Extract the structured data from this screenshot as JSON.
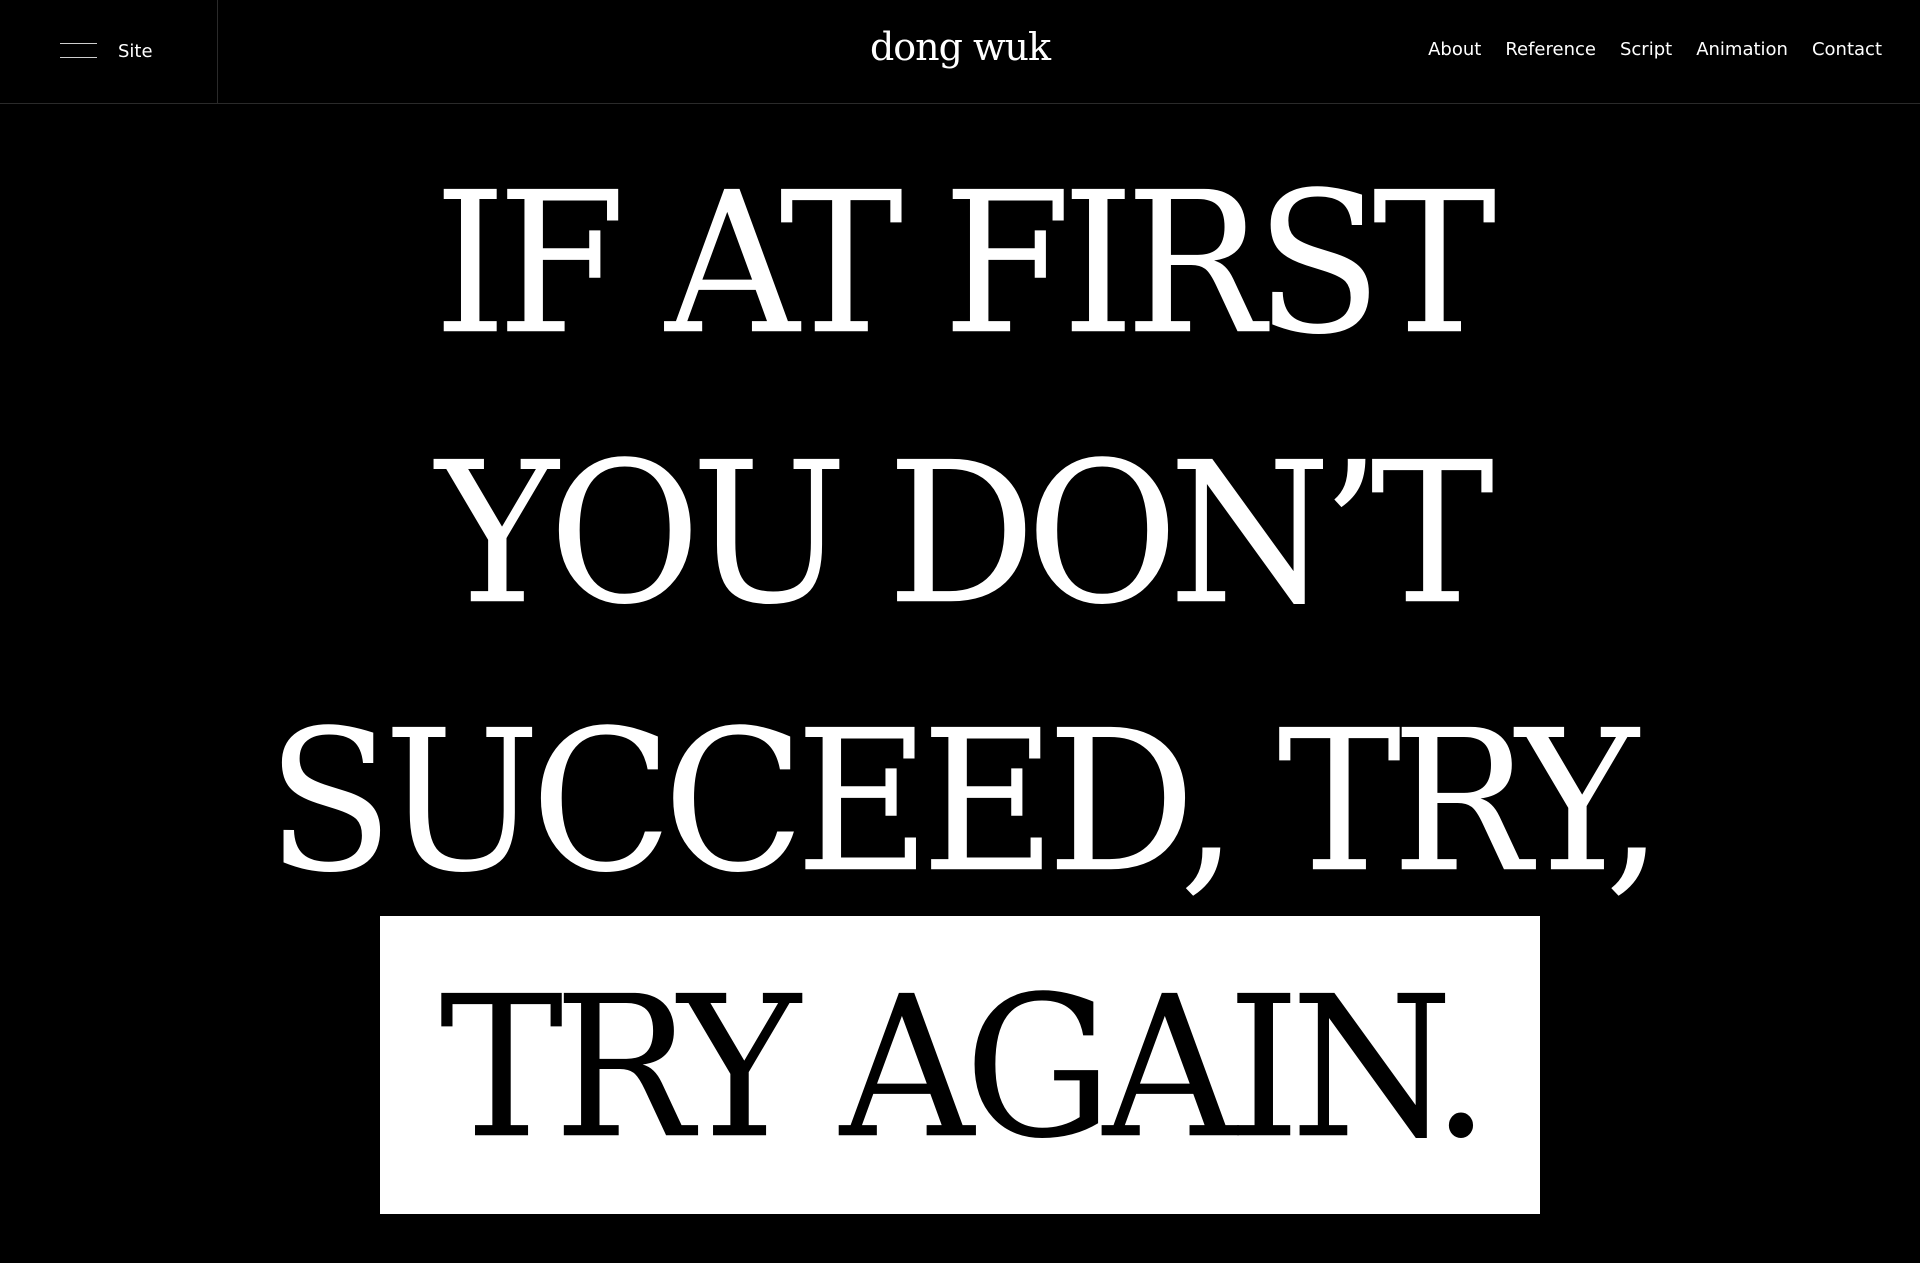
{
  "header": {
    "menu_label": "Site",
    "logo": "dong wuk",
    "nav": [
      "About",
      "Reference",
      "Script",
      "Animation",
      "Contact"
    ]
  },
  "hero": {
    "lines": [
      "IF AT FIRST",
      "YOU DON’T",
      "SUCCEED, TRY,",
      "TRY AGAIN."
    ]
  },
  "colors": {
    "background": "#000000",
    "text": "#ffffff",
    "highlight": "#ffffff",
    "highlight_text": "#000000"
  }
}
